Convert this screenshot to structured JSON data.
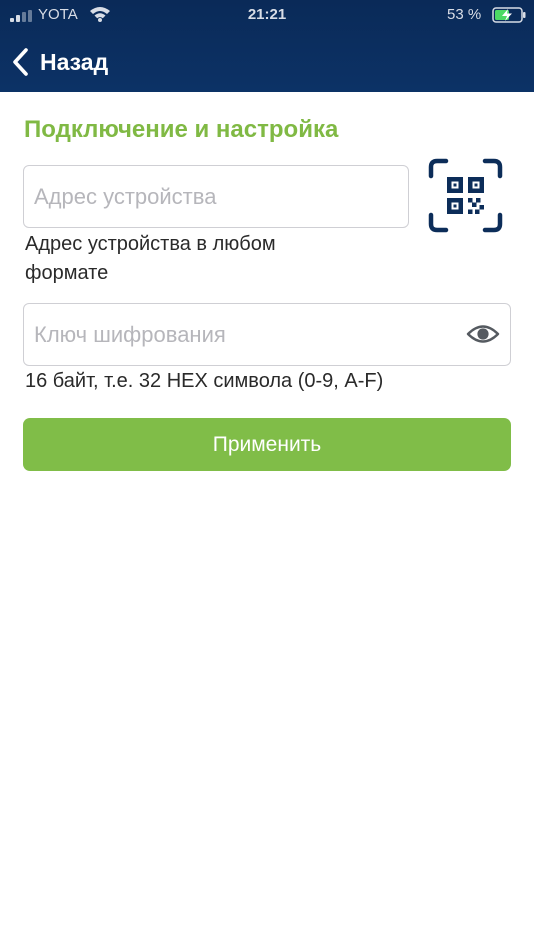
{
  "status_bar": {
    "carrier": "YOTA",
    "time": "21:21",
    "battery_percent": "53 %"
  },
  "nav": {
    "back_label": "Назад"
  },
  "form": {
    "title": "Подключение и настройка",
    "address": {
      "placeholder": "Адрес устройства",
      "value": "",
      "hint": "Адрес устройства в любом формате"
    },
    "key": {
      "placeholder": "Ключ шифрования",
      "value": "",
      "hint": "16 байт, т.е. 32 HEX символа (0-9, A-F)"
    },
    "apply_label": "Применить"
  },
  "icons": {
    "back": "chevron-left-icon",
    "qr": "qr-scan-icon",
    "eye": "eye-icon",
    "signal": "signal-icon",
    "wifi": "wifi-icon",
    "battery": "battery-charging-icon"
  },
  "colors": {
    "header_bg": "#0c3266",
    "accent_green": "#80bd48",
    "title_green": "#80b944",
    "qr_icon": "#0c2d59"
  }
}
